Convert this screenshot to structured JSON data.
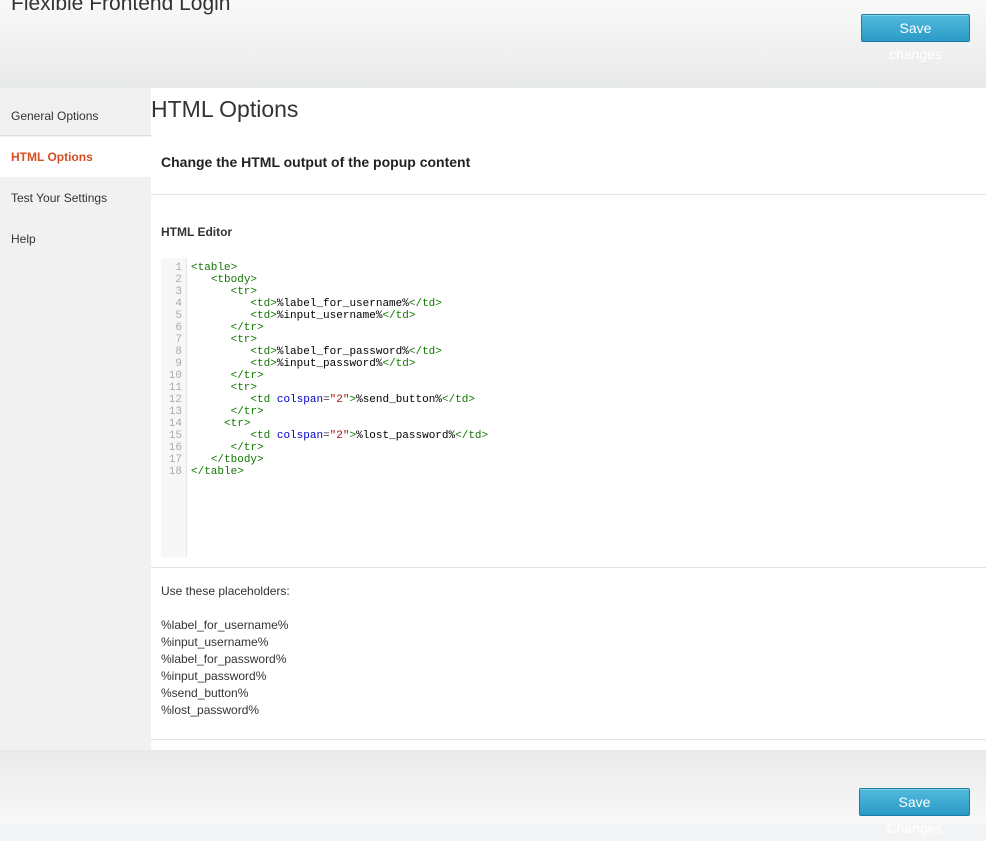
{
  "header": {
    "title": "Flexible Frontend Login",
    "save_label": "Save changes"
  },
  "sidebar": {
    "items": [
      {
        "label": "General Options"
      },
      {
        "label": "HTML Options"
      },
      {
        "label": "Test Your Settings"
      },
      {
        "label": "Help"
      }
    ],
    "active": "HTML Options"
  },
  "main": {
    "page_title": "HTML Options",
    "section_heading": "Change the HTML output of the popup content",
    "editor_label": "HTML Editor",
    "editor_lines": [
      "<table>",
      "   <tbody>",
      "      <tr>",
      "         <td>%label_for_username%</td>",
      "         <td>%input_username%</td>",
      "      </tr>",
      "      <tr>",
      "         <td>%label_for_password%</td>",
      "         <td>%input_password%</td>",
      "      </tr>",
      "      <tr>",
      "         <td colspan=\"2\">%send_button%</td>",
      "      </tr>",
      "     <tr>",
      "         <td colspan=\"2\">%lost_password%</td>",
      "      </tr>",
      "   </tbody>",
      "</table>"
    ],
    "placeholders_intro": "Use these placeholders:",
    "placeholders": [
      "%label_for_username%",
      "%input_username%",
      "%label_for_password%",
      "%input_password%",
      "%send_button%",
      "%lost_password%"
    ]
  },
  "footer": {
    "save_label": "Save Changes"
  },
  "colors": {
    "accent": "#d54e21",
    "button": "#2a9bc6",
    "tag": "#117700",
    "attr": "#0000cc",
    "string": "#aa1111"
  }
}
